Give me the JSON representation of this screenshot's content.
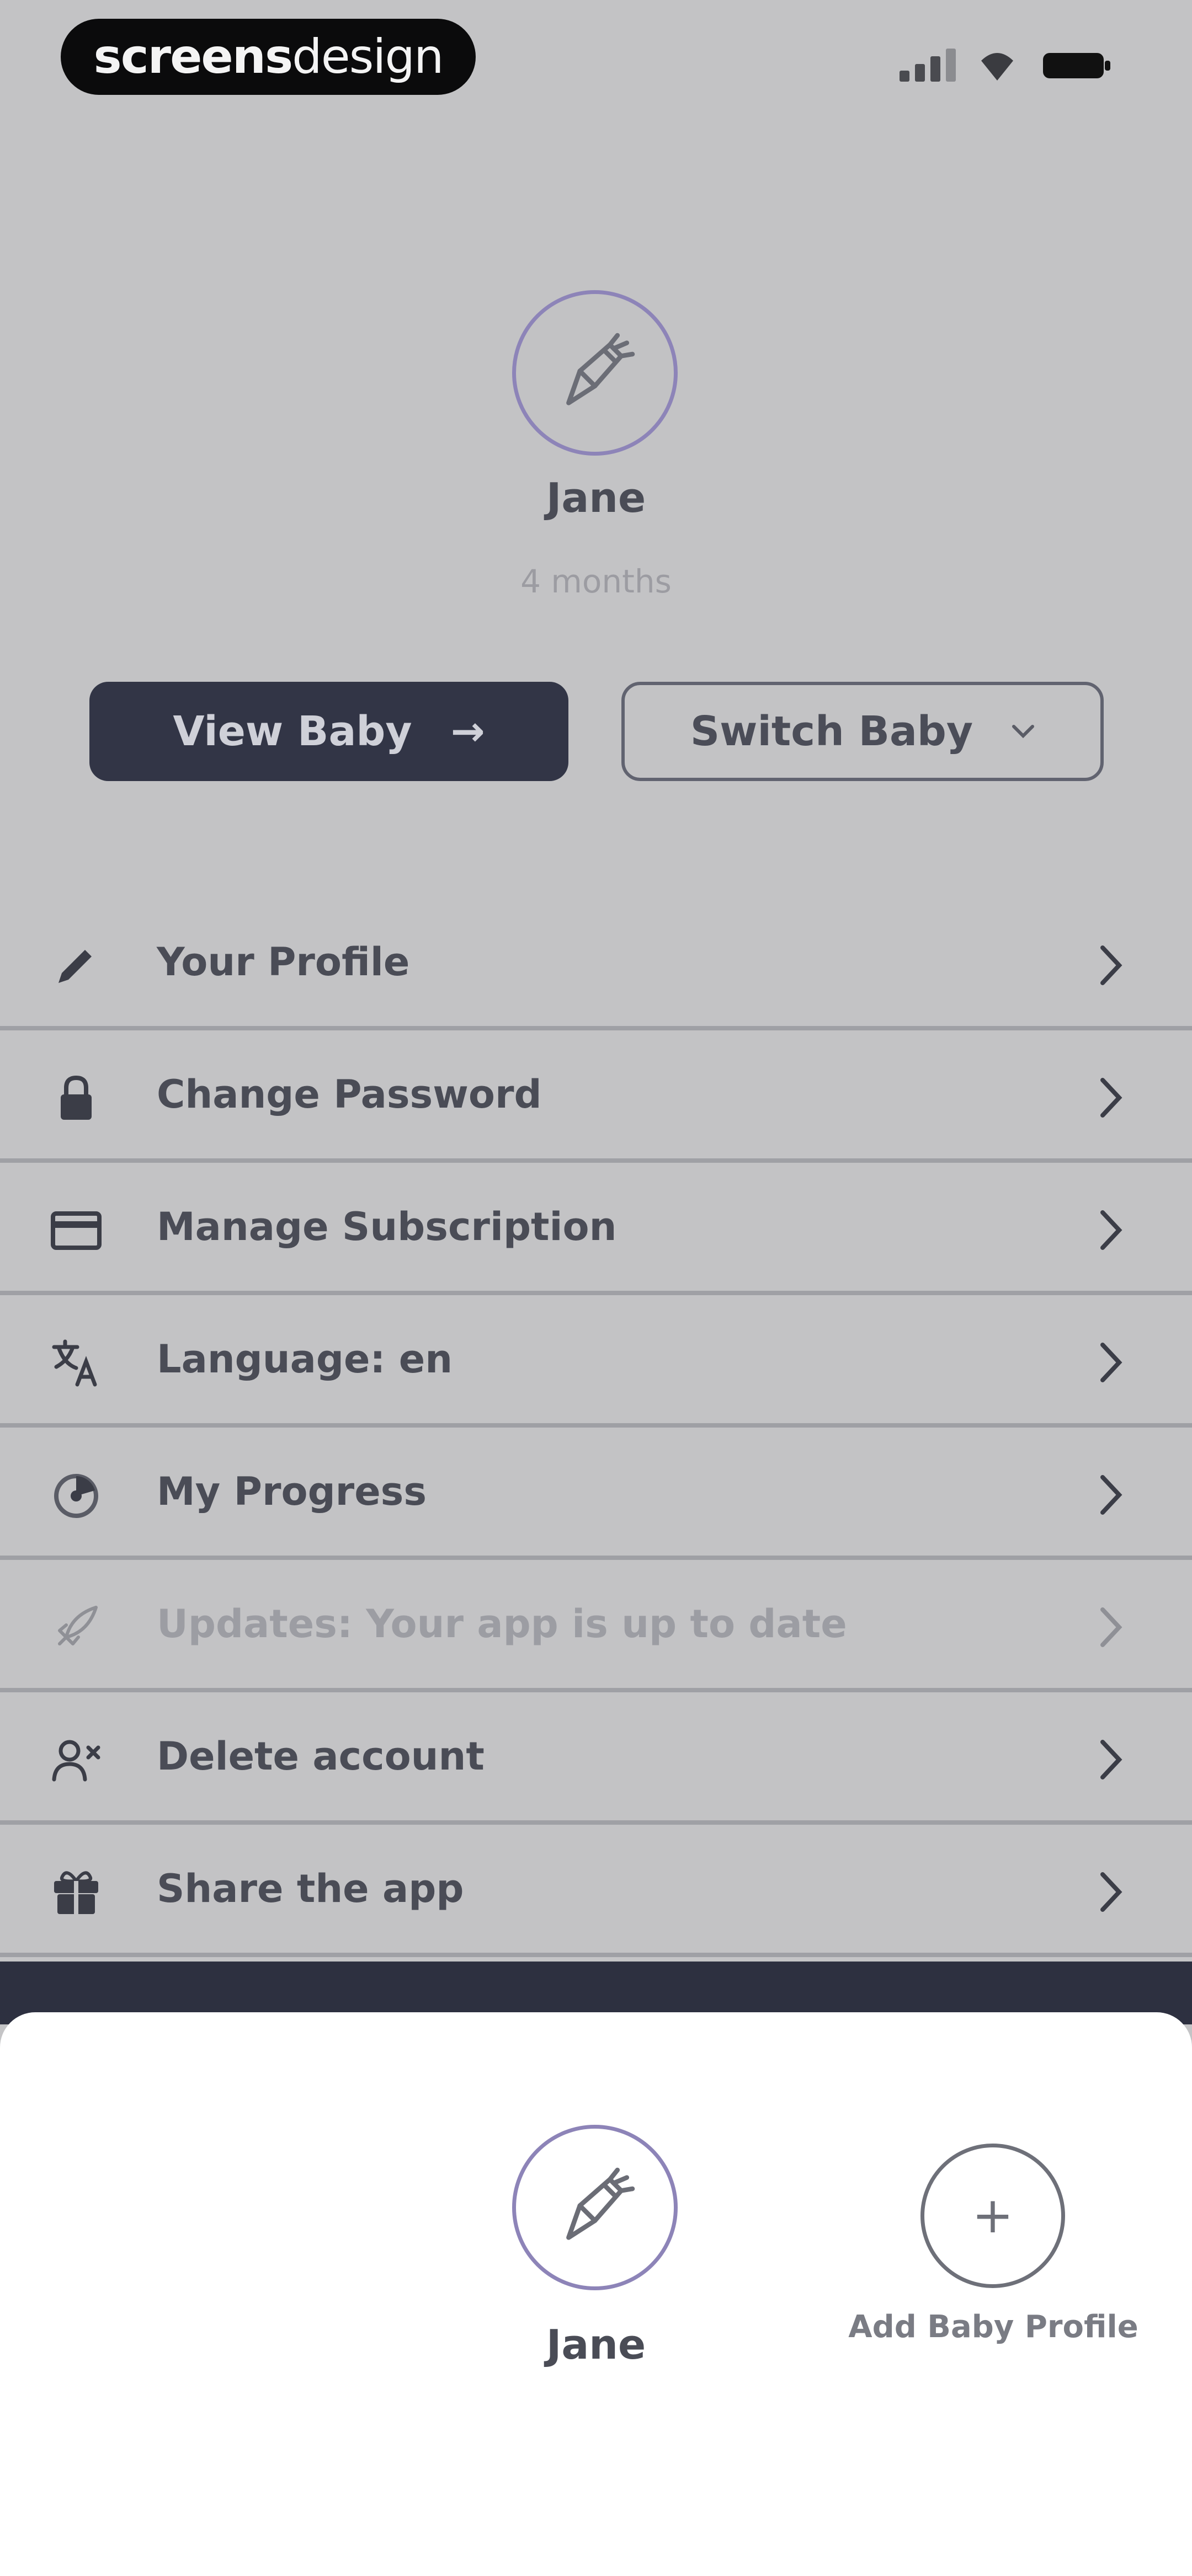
{
  "status_bar": {
    "logo_bold": "screens",
    "logo_light": "design"
  },
  "baby": {
    "name": "Jane",
    "age": "4 months"
  },
  "actions": {
    "view_label": "View Baby",
    "view_arrow": "→",
    "switch_label": "Switch Baby"
  },
  "menu": {
    "items": [
      {
        "label": "Your Profile",
        "icon": "pencil-icon"
      },
      {
        "label": "Change Password",
        "icon": "lock-icon"
      },
      {
        "label": "Manage Subscription",
        "icon": "credit-card-icon"
      },
      {
        "label": "Language: en",
        "icon": "translate-icon"
      },
      {
        "label": "My Progress",
        "icon": "progress-icon"
      },
      {
        "label": "Updates: Your app is up to date",
        "icon": "rocket-icon"
      },
      {
        "label": "Delete account",
        "icon": "remove-user-icon"
      },
      {
        "label": "Share the app",
        "icon": "gift-icon"
      }
    ]
  },
  "sheet": {
    "profile_name": "Jane",
    "add_icon": "+",
    "add_label": "Add Baby Profile"
  },
  "colors": {
    "avatar_ring": "#8d84b8",
    "primary_button": "#323546",
    "sheet": "#ffffff",
    "background": "#c3c3c5"
  }
}
